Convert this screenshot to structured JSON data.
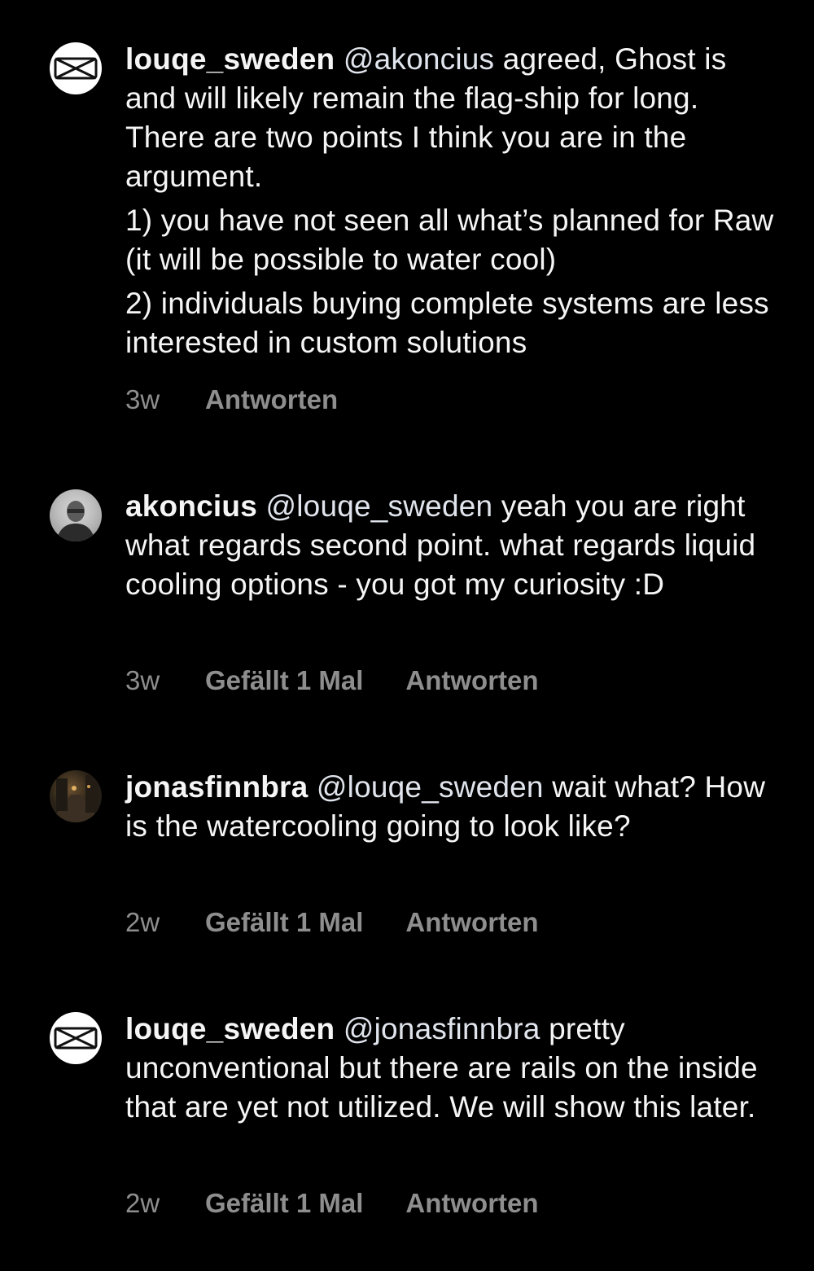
{
  "comments": [
    {
      "username": "louqe_sweden",
      "mention": "@akoncius",
      "paragraphs": [
        "agreed, Ghost is and will likely remain the flag-ship for long. There are two points I think you are in the argument.",
        "1) you have not seen all what’s planned for Raw (it will be possible to water cool)",
        "2) individuals buying complete systems are less interested in custom solutions"
      ],
      "time": "3w",
      "likes": "",
      "reply": "Antworten"
    },
    {
      "username": "akoncius",
      "mention": "@louqe_sweden",
      "paragraphs": [
        "yeah you are right what regards second point. what regards liquid cooling options - you got my curiosity :D"
      ],
      "time": "3w",
      "likes": "Gefällt 1 Mal",
      "reply": "Antworten"
    },
    {
      "username": "jonasfinnbra",
      "mention": "@louqe_sweden",
      "paragraphs": [
        "wait what? How is the watercooling going to look like?"
      ],
      "time": "2w",
      "likes": "Gefällt 1 Mal",
      "reply": "Antworten"
    },
    {
      "username": "louqe_sweden",
      "mention": "@jonasfinnbra",
      "paragraphs": [
        "pretty unconventional but there are rails on the inside that are yet not utilized. We will show this later."
      ],
      "time": "2w",
      "likes": "Gefällt 1 Mal",
      "reply": "Antworten"
    }
  ],
  "colors": {
    "background": "#000000",
    "text": "#f5f5f5",
    "meta": "#8e8e8e"
  },
  "icons": {
    "brand_avatar": "louqe-logo-icon",
    "person_avatar": "user-photo-avatar",
    "street_avatar": "street-photo-avatar"
  }
}
